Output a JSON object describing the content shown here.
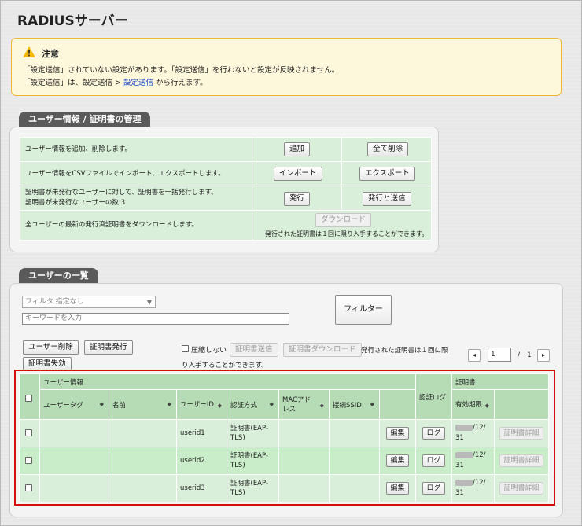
{
  "page": {
    "title": "RADIUSサーバー"
  },
  "notice": {
    "heading": "注意",
    "line1": "「設定送信」されていない設定があります。「設定送信」を行わないと設定が反映されません。",
    "line2_pre": "「設定送信」は、設定送信 > ",
    "line2_link": "設定送信",
    "line2_post": " から行えます。"
  },
  "management": {
    "tab_label": "ユーザー情報 / 証明書の管理",
    "rows": [
      {
        "desc": "ユーザー情報を追加、削除します。",
        "btn1": "追加",
        "btn2": "全て削除"
      },
      {
        "desc": "ユーザー情報をCSVファイルでインポート、エクスポートします。",
        "btn1": "インポート",
        "btn2": "エクスポート"
      },
      {
        "desc": "証明書が未発行なユーザーに対して、証明書を一括発行します。",
        "desc2": "証明書が未発行なユーザーの数:3",
        "btn1": "発行",
        "btn2": "発行と送信"
      },
      {
        "desc": "全ユーザーの最新の発行済証明書をダウンロードします。",
        "btn1": "ダウンロード",
        "note": "発行された証明書は１回に限り入手することができます。"
      }
    ]
  },
  "user_list": {
    "tab_label": "ユーザーの一覧",
    "filter_select": "フィルタ 指定なし",
    "keyword_placeholder": "キーワードを入力",
    "filter_button": "フィルター",
    "delete_button": "ユーザー削除",
    "issue_button": "証明書発行",
    "revoke_button": "証明書失効",
    "no_compress_label": "圧縮しない",
    "send_cert_button": "証明書送信",
    "download_cert_button": "証明書ダウンロード",
    "note_line1": "発行された証明書は１回に限",
    "note_line2": "り入手することができます。",
    "pager": {
      "prev": "◂",
      "page": "1",
      "sep": "/",
      "total": "1",
      "next": "▸"
    },
    "headers": {
      "group_user": "ユーザー情報",
      "group_cert": "証明書",
      "user_tag": "ユーザータグ",
      "name": "名前",
      "user_id": "ユーザーID",
      "auth_method": "認証方式",
      "mac": "MACアドレス",
      "ssid": "接続SSID",
      "auth_log": "認証ログ",
      "expiry": "有効期限"
    },
    "rows": [
      {
        "user_id": "userid1",
        "auth": "証明書(EAP-TLS)",
        "edit": "編集",
        "log": "ログ",
        "expiry_tail": "/12/",
        "expiry_day": "31",
        "detail": "証明書詳細"
      },
      {
        "user_id": "userid2",
        "auth": "証明書(EAP-TLS)",
        "edit": "編集",
        "log": "ログ",
        "expiry_tail": "/12/",
        "expiry_day": "31",
        "detail": "証明書詳細"
      },
      {
        "user_id": "userid3",
        "auth": "証明書(EAP-TLS)",
        "edit": "編集",
        "log": "ログ",
        "expiry_tail": "/12/",
        "expiry_day": "31",
        "detail": "証明書詳細"
      }
    ]
  }
}
